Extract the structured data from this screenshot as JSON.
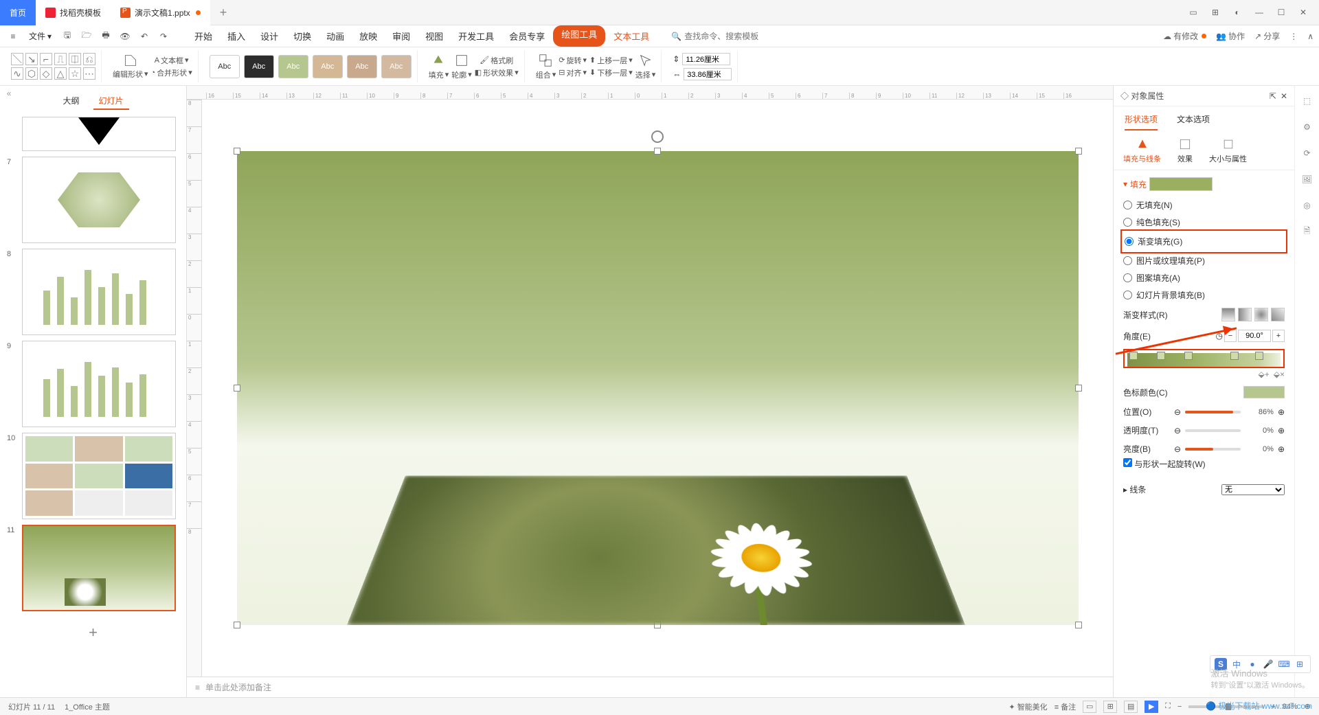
{
  "tabs": {
    "home": "首页",
    "docer": "找稻壳模板",
    "file": "演示文稿1.pptx"
  },
  "ribbon": {
    "file_menu": "文件",
    "tabs": [
      "开始",
      "插入",
      "设计",
      "切换",
      "动画",
      "放映",
      "审阅",
      "视图",
      "开发工具",
      "会员专享"
    ],
    "tool1": "绘图工具",
    "tool2": "文本工具",
    "search_ph": "查找命令、搜索模板",
    "right": {
      "unsaved": "有修改",
      "coop": "协作",
      "share": "分享"
    }
  },
  "toolbar": {
    "edit_shape": "编辑形状",
    "textbox": "文本框",
    "merge": "合并形状",
    "abc": "Abc",
    "fill": "填充",
    "outline": "轮廓",
    "effect": "形状效果",
    "format_painter": "格式刷",
    "group": "组合",
    "align": "对齐",
    "rotate": "旋转",
    "up": "上移一层",
    "down": "下移一层",
    "select": "选择",
    "width": "11.26厘米",
    "height": "33.86厘米"
  },
  "thumbs": {
    "outline": "大纲",
    "slides": "幻灯片",
    "nums": [
      "7",
      "8",
      "9",
      "10",
      "11"
    ]
  },
  "notes_ph": "单击此处添加备注",
  "panel": {
    "title": "对象属性",
    "shape_opt": "形状选项",
    "text_opt": "文本选项",
    "sub1": "填充与线条",
    "sub2": "效果",
    "sub3": "大小与属性",
    "fill_section": "填充",
    "r_none": "无填充(N)",
    "r_solid": "纯色填充(S)",
    "r_grad": "渐变填充(G)",
    "r_pic": "图片或纹理填充(P)",
    "r_pat": "图案填充(A)",
    "r_bg": "幻灯片背景填充(B)",
    "grad_style": "渐变样式(R)",
    "angle": "角度(E)",
    "angle_v": "90.0°",
    "stop_color": "色标颜色(C)",
    "pos": "位置(O)",
    "pos_v": "86%",
    "trans": "透明度(T)",
    "trans_v": "0%",
    "bright": "亮度(B)",
    "bright_v": "0%",
    "rotate_with": "与形状一起旋转(W)",
    "line_section": "线条",
    "line_none": "无"
  },
  "status": {
    "slide": "幻灯片 11 / 11",
    "theme": "1_Office 主题",
    "beautify": "智能美化",
    "notes": "备注",
    "zoom": "94%"
  },
  "watermark": {
    "l1": "激活 Windows",
    "l2": "转到\"设置\"以激活 Windows。"
  },
  "brand": "极光下载站 www.xz7.com",
  "ime": "中"
}
